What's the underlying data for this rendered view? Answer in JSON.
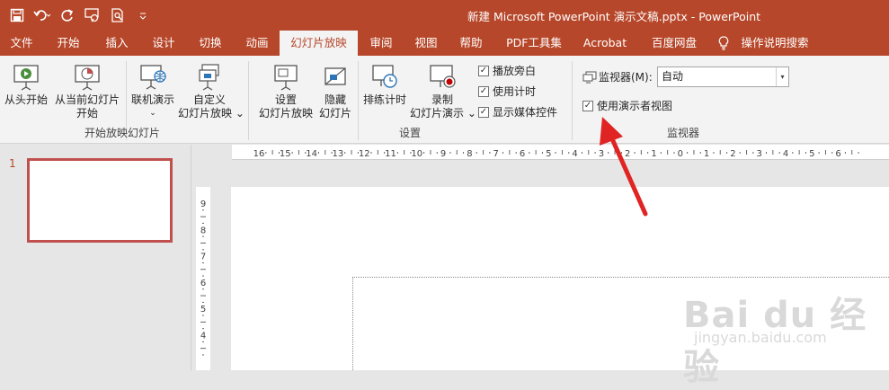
{
  "window": {
    "title": "新建 Microsoft PowerPoint 演示文稿.pptx  -  PowerPoint"
  },
  "quick_access": [
    "save-icon",
    "undo-icon",
    "redo-icon",
    "presenter-icon",
    "print-preview-icon",
    "customize-icon"
  ],
  "tabs": [
    {
      "label": "文件"
    },
    {
      "label": "开始"
    },
    {
      "label": "插入"
    },
    {
      "label": "设计"
    },
    {
      "label": "切换"
    },
    {
      "label": "动画"
    },
    {
      "label": "幻灯片放映"
    },
    {
      "label": "审阅"
    },
    {
      "label": "视图"
    },
    {
      "label": "帮助"
    },
    {
      "label": "PDF工具集"
    },
    {
      "label": "Acrobat"
    },
    {
      "label": "百度网盘"
    },
    {
      "label": "操作说明搜索"
    }
  ],
  "ribbon": {
    "group_start": {
      "label": "开始放映幻灯片",
      "from_beginning": "从头开始",
      "from_current_line1": "从当前幻灯片",
      "from_current_line2": "开始",
      "online_line1": "联机演示",
      "online_line2": "⌄",
      "custom_line1": "自定义",
      "custom_line2": "幻灯片放映 ⌄"
    },
    "group_setup": {
      "label": "设置",
      "setup_line1": "设置",
      "setup_line2": "幻灯片放映",
      "hide_line1": "隐藏",
      "hide_line2": "幻灯片",
      "rehearse": "排练计时",
      "record_line1": "录制",
      "record_line2": "幻灯片演示 ⌄",
      "play_narrations": "播放旁白",
      "use_timings": "使用计时",
      "show_media_controls": "显示媒体控件",
      "check_mark": "✓"
    },
    "group_monitors": {
      "label": "监视器",
      "monitor_label": "监视器(M):",
      "monitor_value": "自动",
      "presenter_view": "使用演示者视图"
    }
  },
  "slides": [
    {
      "number": "1"
    }
  ],
  "ruler": {
    "h_labels": [
      "16",
      "15",
      "14",
      "13",
      "12",
      "11",
      "10",
      "9",
      "8",
      "7",
      "6",
      "5",
      "4",
      "3",
      "2",
      "1",
      "0",
      "1",
      "2",
      "3",
      "4",
      "5",
      "6"
    ],
    "v_labels": [
      "9",
      "8",
      "7",
      "6",
      "5",
      "4"
    ]
  },
  "watermark": {
    "line1": "Bai du 经验",
    "line2": "jingyan.baidu.com"
  },
  "colors": {
    "accent": "#b7472a",
    "annotation_arrow": "#e02424"
  }
}
